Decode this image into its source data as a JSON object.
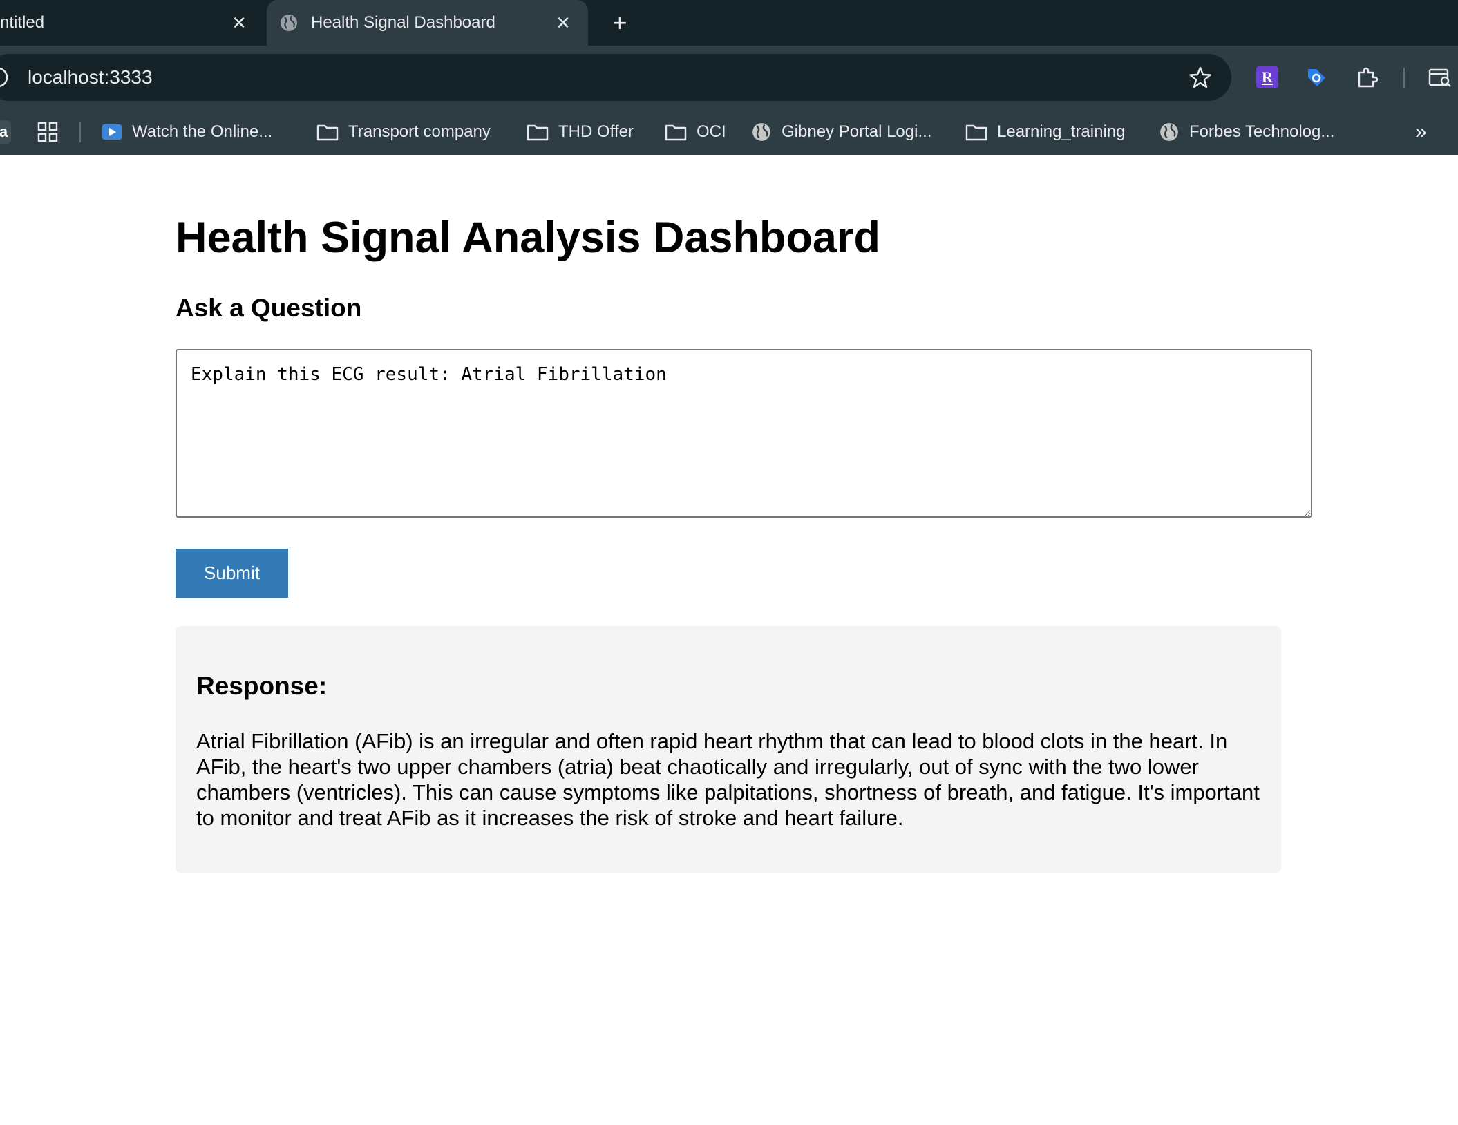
{
  "browser": {
    "tabs": [
      {
        "title": "ntitled",
        "active": false
      },
      {
        "title": "Health Signal Dashboard",
        "active": true
      }
    ],
    "new_tab_label": "+",
    "close_glyph": "✕",
    "url": "localhost:3333",
    "extensions": [
      {
        "icon": "r-extension-icon",
        "label": "R",
        "color": "#6b3fd4"
      },
      {
        "icon": "tag-extension-icon",
        "color": "#2b7de9"
      },
      {
        "icon": "puzzle-icon"
      },
      {
        "icon": "tab-search-icon"
      }
    ],
    "bookmarks_stub": "a",
    "bookmarks": [
      {
        "label": "Watch the Online...",
        "icon": "video-icon"
      },
      {
        "label": "Transport company",
        "icon": "folder-icon"
      },
      {
        "label": "THD Offer",
        "icon": "folder-icon"
      },
      {
        "label": "OCI",
        "icon": "folder-icon"
      },
      {
        "label": "Gibney Portal Logi...",
        "icon": "globe-icon"
      },
      {
        "label": "Learning_training",
        "icon": "folder-icon"
      },
      {
        "label": "Forbes Technolog...",
        "icon": "globe-icon"
      }
    ],
    "bookmarks_more": "»"
  },
  "page": {
    "title": "Health Signal Analysis Dashboard",
    "ask_heading": "Ask a Question",
    "question_value": "Explain this ECG result: Atrial Fibrillation",
    "submit_label": "Submit",
    "response_heading": "Response:",
    "response_text": "Atrial Fibrillation (AFib) is an irregular and often rapid heart rhythm that can lead to blood clots in the heart. In AFib, the heart's two upper chambers (atria) beat chaotically and irregularly, out of sync with the two lower chambers (ventricles). This can cause symptoms like palpitations, shortness of breath, and fatigue. It's important to monitor and treat AFib as it increases the risk of stroke and heart failure."
  },
  "colors": {
    "chrome_dark": "#152329",
    "chrome_toolbar": "#2e3c44",
    "submit_button": "#337ab7",
    "response_bg": "#f4f4f4"
  }
}
